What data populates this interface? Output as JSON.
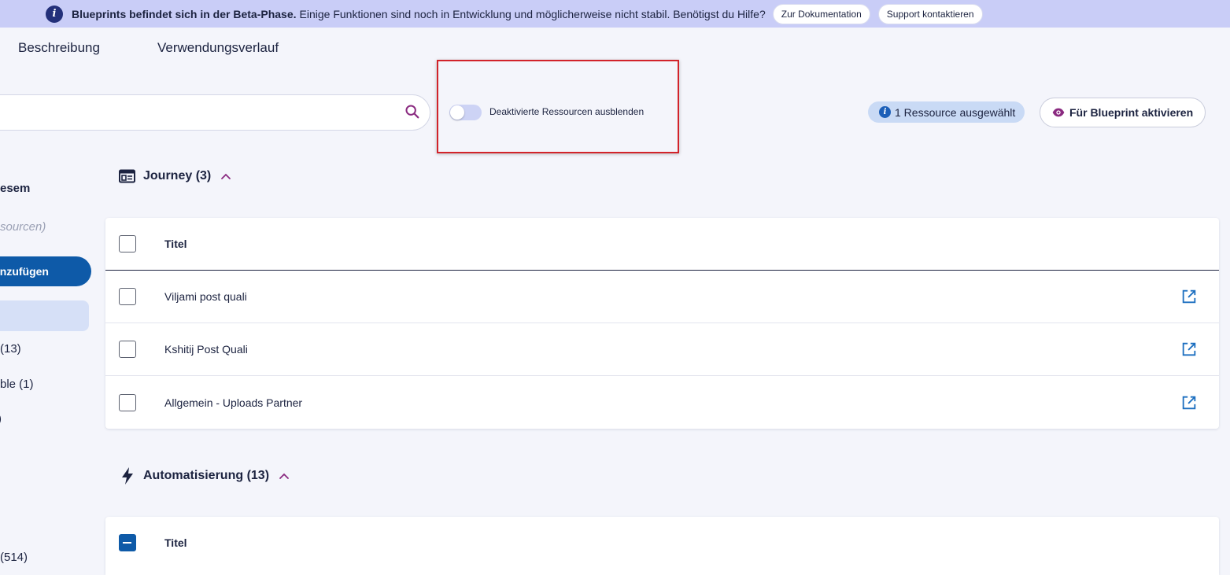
{
  "banner": {
    "info_icon": "i",
    "bold": "Blueprints befindet sich in der Beta-Phase.",
    "text": "Einige Funktionen sind noch in Entwicklung und möglicherweise nicht stabil. Benötigst du Hilfe?",
    "doc_button": "Zur Dokumentation",
    "support_button": "Support kontaktieren"
  },
  "tabs": [
    "Beschreibung",
    "Verwendungsverlauf"
  ],
  "search": {
    "placeholder": ""
  },
  "toggle": {
    "label": "Deaktivierte Ressourcen ausblenden",
    "on": false
  },
  "selection": {
    "badge_icon": "i",
    "badge": "1 Ressource ausgewählt",
    "activate": "Für Blueprint aktivieren"
  },
  "sidebar": {
    "heading": "esem",
    "subtitle": "sourcen)",
    "add_button": "nzufügen",
    "items": [
      "(13)",
      "ble (1)",
      ")",
      " (514)"
    ]
  },
  "sections": [
    {
      "title": "Journey (3)",
      "column": "Titel",
      "rows": [
        "Viljami post quali",
        "Kshitij Post Quali",
        "Allgemein - Uploads Partner"
      ]
    },
    {
      "title": "Automatisierung (13)",
      "column": "Titel",
      "rows": []
    }
  ],
  "colors": {
    "accent": "#0e5aa8",
    "banner": "#c9cdf7",
    "highlight": "#d2232a",
    "brand_purple": "#8a2a80"
  }
}
